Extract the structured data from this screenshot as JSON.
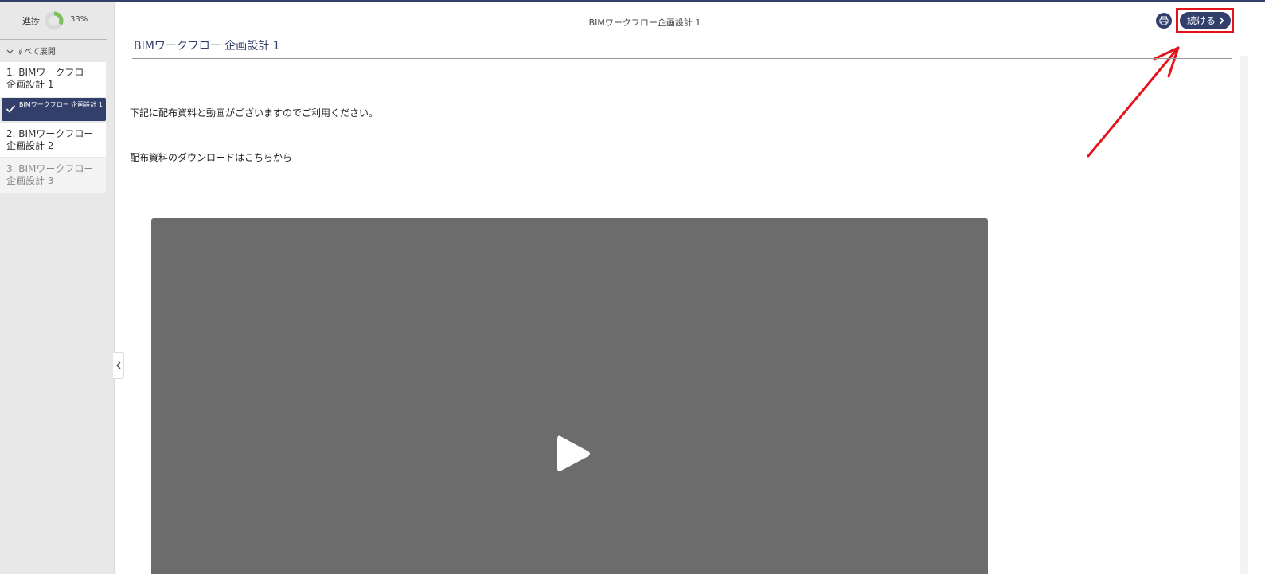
{
  "colors": {
    "accent": "#323f6b",
    "progress": "#7cc15e",
    "highlight": "#e3131b",
    "video_bg": "#6c6c6c"
  },
  "sidebar": {
    "progress_label": "進捗",
    "progress_percent_text": "33%",
    "progress_value": 0.33,
    "expand_all": "すべて展開",
    "items": [
      {
        "label": "1. BIMワークフロー企画設計 1",
        "state": "enabled"
      },
      {
        "label": "BIMワークフロー 企画設計 1",
        "state": "active-complete"
      },
      {
        "label": "2. BIMワークフロー企画設計 2",
        "state": "enabled"
      },
      {
        "label": "3. BIMワークフロー企画設計 3",
        "state": "disabled"
      }
    ]
  },
  "header": {
    "title": "BIMワークフロー企画設計 1",
    "continue_label": "続ける",
    "print_icon": "print-icon"
  },
  "content": {
    "page_title": "BIMワークフロー 企画設計 1",
    "intro": "下記に配布資料と動画がございますのでご利用ください。",
    "download_link": "配布資料のダウンロードはこちらから"
  }
}
